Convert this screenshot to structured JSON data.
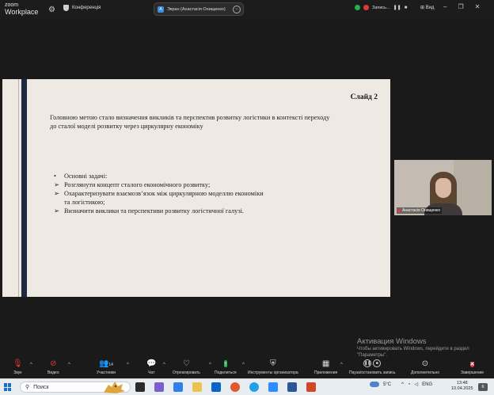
{
  "app": {
    "brand_line1": "zoom",
    "brand_line2": "Workplace",
    "meeting_label": "Конференція"
  },
  "share_pill": {
    "avatar_letter": "A",
    "label": "Экран (Анастасія Онищенко)"
  },
  "recording": {
    "label": "Запись..."
  },
  "view": {
    "label": "Вид"
  },
  "slide": {
    "number": "Слайд 2",
    "main_text": "Головною метою стало визначення викликів та перспектив розвитку логістики в контексті переходу до сталої моделі розвитку через циркулярну економіку",
    "tasks": [
      {
        "marker": "•",
        "text": "Основні задачі:",
        "wrap": ""
      },
      {
        "marker": "➢",
        "text": "Розглянути концепт сталого економічного розвитку;",
        "wrap": ""
      },
      {
        "marker": "➢",
        "text": "Охарактеризувати взаємозв’язок між циркулярною моделлю економіки",
        "wrap": "та логістикою;"
      },
      {
        "marker": "➢",
        "text": "Визначити виклики та перспективи розвитку логістичної галузі.",
        "wrap": ""
      }
    ]
  },
  "participant": {
    "name": "Анастасія Онищенко"
  },
  "activation": {
    "title": "Активация Windows",
    "subtitle": "Чтобы активировать Windows, перейдите в раздел \"Параметры\"."
  },
  "toolbar": {
    "audio": "Звук",
    "video": "Видео",
    "participants": "Участники",
    "participants_count": "14",
    "chat": "Чат",
    "reactions": "Отреагировать",
    "share": "Поделиться",
    "host_tools": "Инструменты организатора",
    "apps": "Приложения",
    "pause_recording": "Пауза/остановить запись",
    "more": "Дополнительно",
    "end": "Завершение"
  },
  "taskbar": {
    "search_placeholder": "Поиск",
    "weather": "5°C",
    "language": "ENG",
    "time": "13:48",
    "date": "10.04.2025",
    "notifications": "6"
  },
  "colors": {
    "background": "#1a1a1a",
    "slide_bg": "#eeeae3",
    "slide_accent": "#1e2a40",
    "recording_red": "#e03b3b",
    "secure_green": "#22b14c"
  }
}
